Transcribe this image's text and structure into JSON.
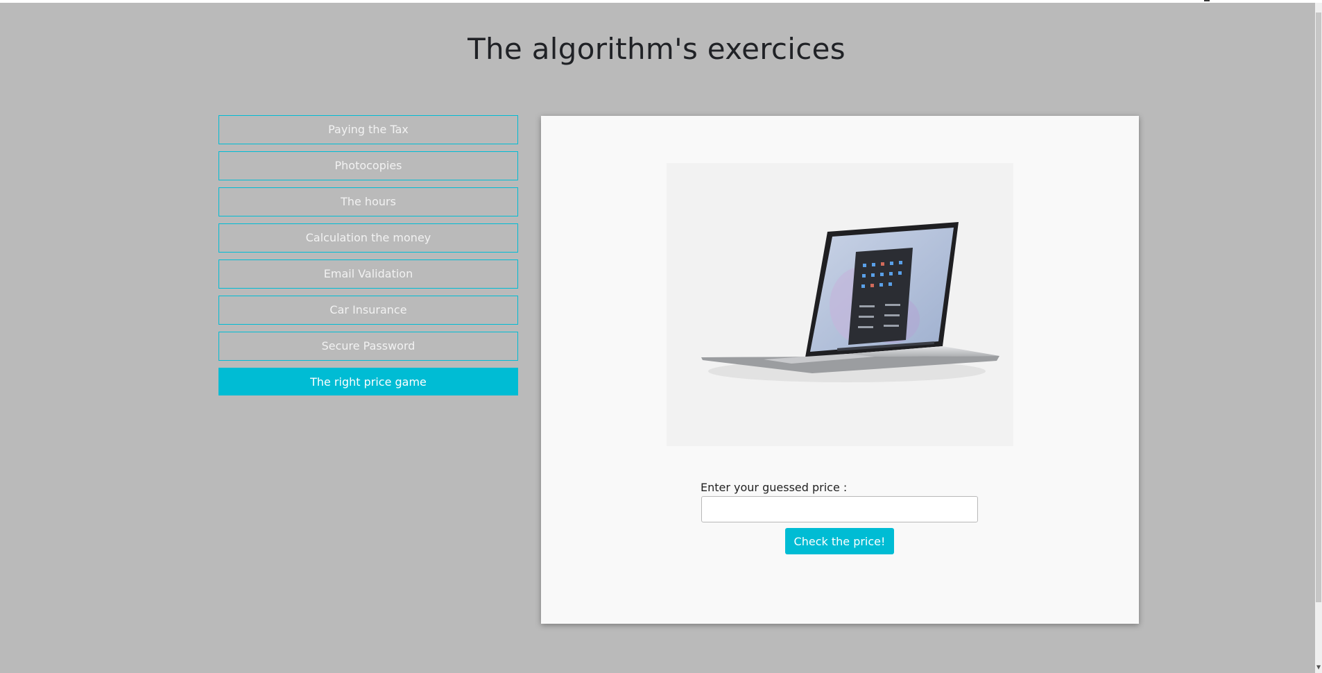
{
  "header": {
    "title": "The algorithm's exercices"
  },
  "menu": {
    "items": [
      {
        "label": "Paying the Tax",
        "active": false
      },
      {
        "label": "Photocopies",
        "active": false
      },
      {
        "label": "The hours",
        "active": false
      },
      {
        "label": "Calculation the money",
        "active": false
      },
      {
        "label": "Email Validation",
        "active": false
      },
      {
        "label": "Car Insurance",
        "active": false
      },
      {
        "label": "Secure Password",
        "active": false
      },
      {
        "label": "The right price game",
        "active": true
      }
    ]
  },
  "game": {
    "image_icon": "laptop-product-image",
    "input_label": "Enter your guessed price :",
    "input_value": "",
    "button_label": "Check the price!"
  },
  "colors": {
    "background": "#bababa",
    "accent": "#00bcd4",
    "panel": "#f9f9f9"
  }
}
